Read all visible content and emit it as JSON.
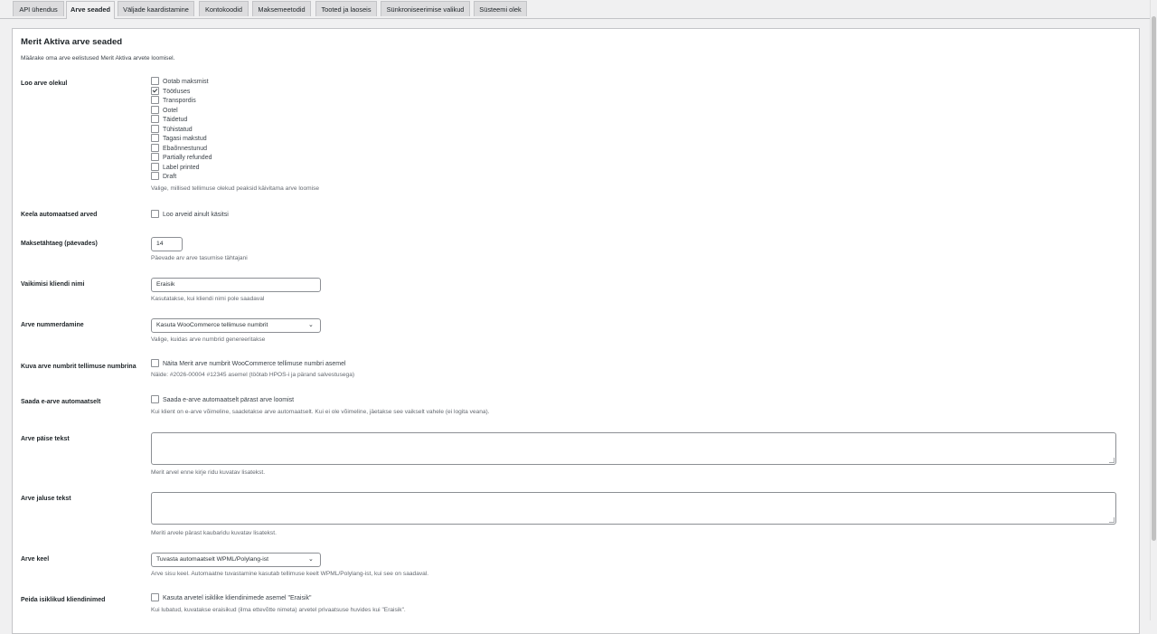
{
  "tabs": [
    {
      "label": "API ühendus"
    },
    {
      "label": "Arve seaded"
    },
    {
      "label": "Väljade kaardistamine"
    },
    {
      "label": "Kontokoodid"
    },
    {
      "label": "Maksemeetodid"
    },
    {
      "label": "Tooted ja laoseis"
    },
    {
      "label": "Sünkroniseerimise valikud"
    },
    {
      "label": "Süsteemi olek"
    }
  ],
  "active_tab": "Arve seaded",
  "section": {
    "title": "Merit Aktiva arve seaded",
    "description": "Määrake oma arve eelistused Merit Aktiva arvete loomisel."
  },
  "order_status": {
    "label": "Loo arve olekul",
    "options": [
      {
        "label": "Ootab maksmist",
        "checked": false
      },
      {
        "label": "Töötluses",
        "checked": true
      },
      {
        "label": "Transpordis",
        "checked": false
      },
      {
        "label": "Ootel",
        "checked": false
      },
      {
        "label": "Täidetud",
        "checked": false
      },
      {
        "label": "Tühistatud",
        "checked": false
      },
      {
        "label": "Tagasi makstud",
        "checked": false
      },
      {
        "label": "Ebaõnnestunud",
        "checked": false
      },
      {
        "label": "Partially refunded",
        "checked": false
      },
      {
        "label": "Label printed",
        "checked": false
      },
      {
        "label": "Draft",
        "checked": false
      }
    ],
    "help": "Valige, millised tellimuse olekud peaksid käivitama arve loomise"
  },
  "disable_auto": {
    "label": "Keela automaatsed arved",
    "checkbox_label": "Loo arveid ainult käsitsi",
    "checked": false
  },
  "due_days": {
    "label": "Maksetähtaeg (päevades)",
    "value": "14",
    "help": "Päevade arv arve tasumise tähtajani"
  },
  "default_customer": {
    "label": "Vaikimisi kliendi nimi",
    "value": "Eraisik",
    "help": "Kasutatakse, kui kliendi nimi pole saadaval"
  },
  "numbering": {
    "label": "Arve nummerdamine",
    "value": "Kasuta WooCommerce tellimuse numbrit",
    "help": "Valige, kuidas arve numbrid genereeritakse"
  },
  "show_number": {
    "label": "Kuva arve numbrit tellimuse numbrina",
    "checkbox_label": "Näita Merit arve numbrit WooCommerce tellimuse numbri asemel",
    "checked": false,
    "help": "Näide: #2026-00004 #12345 asemel (töötab HPOS-i ja pärand salvestusega)"
  },
  "e_invoice": {
    "label": "Saada e-arve automaatselt",
    "checkbox_label": "Saada e-arve automaatselt pärast arve loomist",
    "checked": false,
    "help": "Kui klient on e-arve võimeline, saadetakse arve automaatselt. Kui ei ole võimeline, jäetakse see vaikselt vahele (ei logita veana)."
  },
  "header_text": {
    "label": "Arve päise tekst",
    "value": "",
    "help": "Merit arvel enne kirje ridu kuvatav lisatekst."
  },
  "footer_text": {
    "label": "Arve jaluse tekst",
    "value": "",
    "help": "Meriti arvele pärast kaubaridu kuvatav lisatekst."
  },
  "language": {
    "label": "Arve keel",
    "value": "Tuvasta automaatselt WPML/Polylang-ist",
    "help": "Arve sisu keel. Automaatne tuvastamine kasutab tellimuse keelt WPML/Polylang-ist, kui see on saadaval."
  },
  "hide_private": {
    "label": "Peida isiklikud kliendinimed",
    "checkbox_label": "Kasuta arvetel isiklike kliendinimede asemel \"Eraisik\"",
    "checked": false,
    "help": "Kui lubatud, kuvatakse eraisikud (ilma ettevõtte nimeta) arvetel privaatsuse huvides kui \"Eraisik\"."
  }
}
